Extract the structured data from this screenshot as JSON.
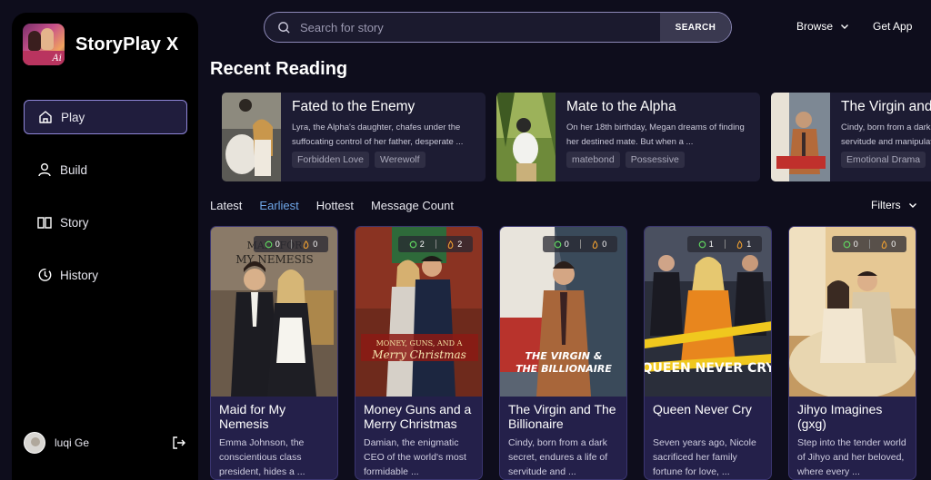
{
  "brand": {
    "name": "StoryPlay X",
    "logo_text": "Ai"
  },
  "nav": [
    {
      "label": "Play",
      "icon": "home-icon",
      "active": true
    },
    {
      "label": "Build",
      "icon": "person-icon",
      "active": false
    },
    {
      "label": "Story",
      "icon": "book-icon",
      "active": false
    },
    {
      "label": "History",
      "icon": "history-icon",
      "active": false
    }
  ],
  "user": {
    "name": "luqi Ge"
  },
  "search": {
    "placeholder": "Search for story",
    "button": "SEARCH"
  },
  "header": {
    "browse": "Browse",
    "get_app": "Get App"
  },
  "recent": {
    "title": "Recent Reading",
    "items": [
      {
        "title": "Fated to the Enemy",
        "desc": "Lyra, the Alpha's daughter, chafes under the suffocating control of her father, desperate ...",
        "tags": [
          "Forbidden Love",
          "Werewolf"
        ]
      },
      {
        "title": "Mate to the Alpha",
        "desc": "On her 18th birthday, Megan dreams of finding her destined mate. But when a ...",
        "tags": [
          "matebond",
          "Possessive"
        ]
      },
      {
        "title": "The Virgin and the Billionaire",
        "desc": "Cindy, born from a dark secret, endures a life of servitude and manipulation",
        "tags": [
          "Emotional Drama"
        ]
      }
    ]
  },
  "sorts": [
    "Latest",
    "Earliest",
    "Hottest",
    "Message Count"
  ],
  "active_sort": "Earliest",
  "filters_label": "Filters",
  "stories": [
    {
      "title": "Maid for My Nemesis",
      "desc": "Emma Johnson, the conscientious class president, hides a ...",
      "chats": "0",
      "likes": "0",
      "cover_text": "MAID FOR MY NEMESIS"
    },
    {
      "title": "Money Guns and a Merry Christmas",
      "desc": "Damian, the enigmatic CEO of the world's most formidable ...",
      "chats": "2",
      "likes": "2",
      "cover_text": "MONEY, GUNS, AND A Merry Christmas"
    },
    {
      "title": "The Virgin and The Billionaire",
      "desc": "Cindy, born from a dark secret, endures a life of servitude and ...",
      "chats": "0",
      "likes": "0",
      "cover_text": "THE VIRGIN & THE BILLIONAIRE"
    },
    {
      "title": "Queen Never Cry",
      "desc": "Seven years ago, Nicole sacrificed her family fortune for love, ...",
      "chats": "1",
      "likes": "1",
      "cover_text": "QUEEN NEVER CRY"
    },
    {
      "title": "Jihyo Imagines (gxg)",
      "desc": "Step into the tender world of Jihyo and her beloved, where every ...",
      "chats": "0",
      "likes": "0",
      "cover_text": ""
    }
  ]
}
